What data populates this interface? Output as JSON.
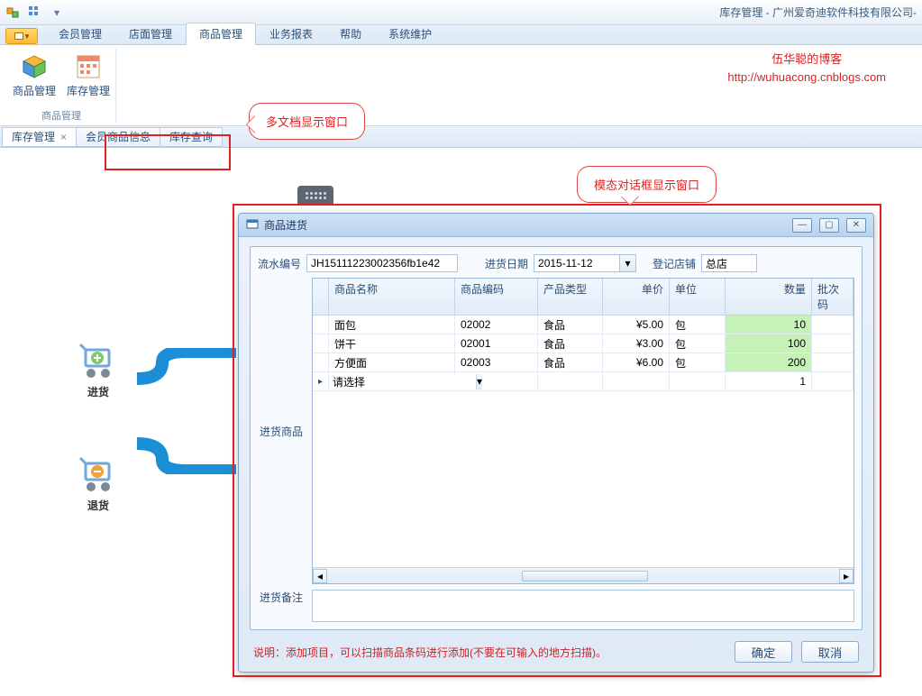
{
  "app_title": "库存管理 - 广州爱奇迪软件科技有限公司-",
  "menu_tabs": [
    "会员管理",
    "店面管理",
    "商品管理",
    "业务报表",
    "帮助",
    "系统维护"
  ],
  "menu_active_index": 2,
  "ribbon": {
    "group_title": "商品管理",
    "buttons": [
      {
        "label": "商品管理",
        "icon": "cube"
      },
      {
        "label": "库存管理",
        "icon": "calendar"
      }
    ]
  },
  "doc_tabs": [
    {
      "label": "库存管理",
      "active": true,
      "closable": true
    },
    {
      "label": "会员商品信息",
      "active": false,
      "closable": false
    },
    {
      "label": "库存查询",
      "active": false,
      "closable": false
    }
  ],
  "callouts": {
    "multi_doc": "多文档显示窗口",
    "modal": "模态对话框显示窗口"
  },
  "blog": {
    "line1": "伍华聪的博客",
    "line2": "http://wuhuacong.cnblogs.com"
  },
  "flow": {
    "in": "进货",
    "out": "退货"
  },
  "dialog": {
    "title": "商品进货",
    "serial_label": "流水编号",
    "serial_value": "JH15111223002356fb1e42",
    "date_label": "进货日期",
    "date_value": "2015-11-12",
    "store_label": "登记店铺",
    "store_value": "总店",
    "grid_side_label": "进货商品",
    "columns": [
      "商品名称",
      "商品编码",
      "产品类型",
      "单价",
      "单位",
      "数量",
      "批次码"
    ],
    "rows": [
      {
        "name": "面包",
        "code": "02002",
        "type": "食品",
        "price": "¥5.00",
        "unit": "包",
        "qty": "10"
      },
      {
        "name": "饼干",
        "code": "02001",
        "type": "食品",
        "price": "¥3.00",
        "unit": "包",
        "qty": "100"
      },
      {
        "name": "方便面",
        "code": "02003",
        "type": "食品",
        "price": "¥6.00",
        "unit": "包",
        "qty": "200"
      }
    ],
    "new_row_placeholder": "请选择",
    "new_row_qty": "1",
    "remarks_label": "进货备注",
    "instruction": "说明：添加项目，可以扫描商品条码进行添加(不要在可输入的地方扫描)。",
    "ok": "确定",
    "cancel": "取消"
  }
}
